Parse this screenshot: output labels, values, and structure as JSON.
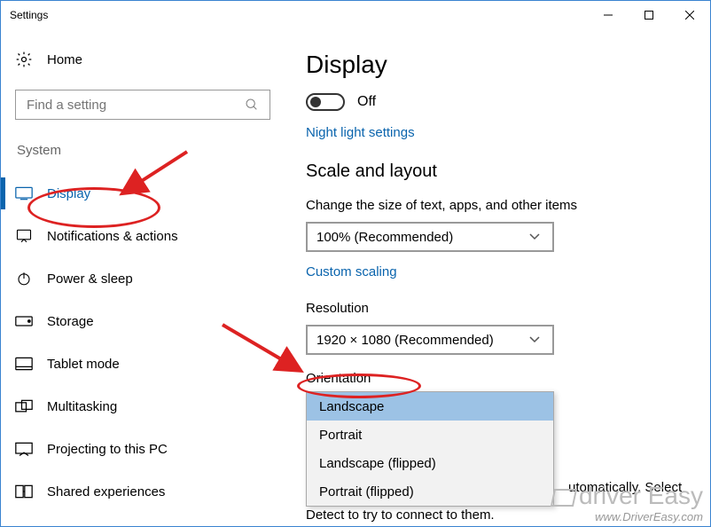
{
  "window": {
    "title": "Settings"
  },
  "sidebar": {
    "home": "Home",
    "search_placeholder": "Find a setting",
    "group": "System",
    "items": [
      {
        "label": "Display"
      },
      {
        "label": "Notifications & actions"
      },
      {
        "label": "Power & sleep"
      },
      {
        "label": "Storage"
      },
      {
        "label": "Tablet mode"
      },
      {
        "label": "Multitasking"
      },
      {
        "label": "Projecting to this PC"
      },
      {
        "label": "Shared experiences"
      }
    ]
  },
  "main": {
    "title": "Display",
    "toggle_state": "Off",
    "night_light_link": "Night light settings",
    "scale_heading": "Scale and layout",
    "scale_label": "Change the size of text, apps, and other items",
    "scale_value": "100% (Recommended)",
    "custom_scaling_link": "Custom scaling",
    "resolution_label": "Resolution",
    "resolution_value": "1920 × 1080 (Recommended)",
    "orientation_label": "Orientation",
    "orientation_options": [
      "Landscape",
      "Portrait",
      "Landscape (flipped)",
      "Portrait (flipped)"
    ],
    "orientation_selected": "Landscape",
    "residual_text_right": "utomatically. Select",
    "residual_text_bottom": "Detect to try to connect to them."
  },
  "watermark": {
    "brand_a": "driver",
    "brand_b": "Easy",
    "url": "www.DriverEasy.com"
  }
}
